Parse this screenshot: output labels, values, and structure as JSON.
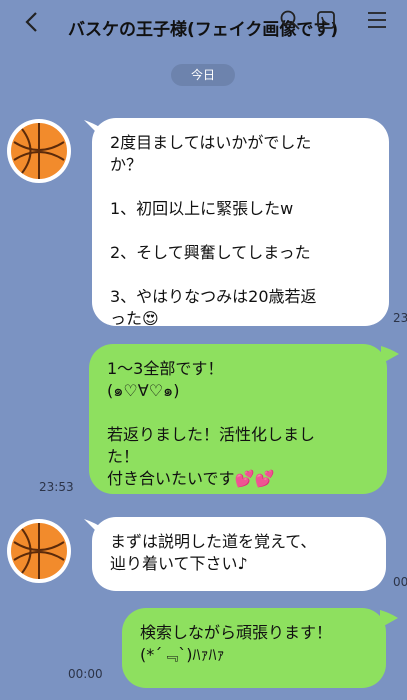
{
  "header": {
    "back_icon": "chevron-left-icon",
    "title": "バスケの王子様(フェイク画像です)",
    "icons": [
      "search-icon",
      "phone-icon",
      "menu-icon"
    ]
  },
  "date_chip": "今日",
  "messages": [
    {
      "sender": "other",
      "text": "2度目ましてはいかがでした\nか？\n\n1、初回以上に緊張したw\n\n2、そして興奮してしまった\n\n3、やはりなつみは20歳若返\nった😍",
      "time": "23"
    },
    {
      "sender": "me",
      "text": "1〜3全部です！\n(๑♡∀♡๑)\n\n若返りました！活性化しまし\nた！\n付き合いたいです💕💕",
      "time": "23:53"
    },
    {
      "sender": "other",
      "text": "まずは説明した道を覚えて、\n辿り着いて下さい♪",
      "time": "00"
    },
    {
      "sender": "me",
      "text": "検索しながら頑張ります！\n(*´﹃`)ﾊｧﾊｧ",
      "time": "00:00"
    }
  ],
  "colors": {
    "background": "#7b93c2",
    "incoming_bubble": "#ffffff",
    "outgoing_bubble": "#8ee05f"
  }
}
